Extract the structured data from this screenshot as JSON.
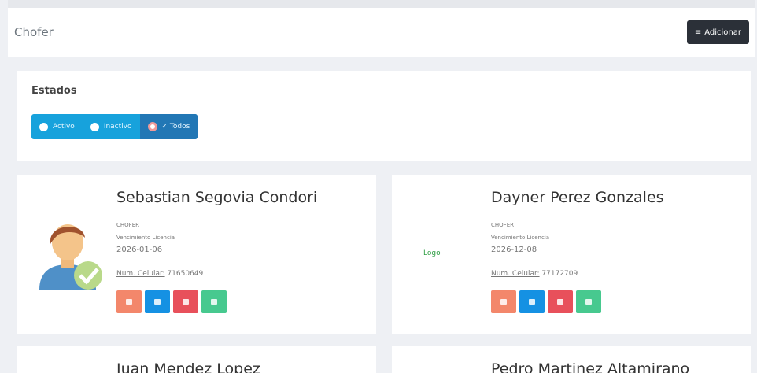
{
  "header": {
    "title": "Chofer",
    "add_label": "Adicionar",
    "add_icon": "list-icon"
  },
  "estados": {
    "label": "Estados",
    "options": [
      {
        "label": "Activo",
        "active": false
      },
      {
        "label": "Inactivo",
        "active": false
      },
      {
        "label": "✓ Todos",
        "active": true
      }
    ]
  },
  "cards": [
    {
      "name": "Sebastian Segovia Condori",
      "role": "CHOFER",
      "license_label": "Vencimiento Licencia",
      "license_date": "2026-01-06",
      "phone_label": "Num. Celular:",
      "phone": "71650649",
      "avatar": "driver-avatar-icon"
    },
    {
      "name": "Dayner Perez Gonzales",
      "role": "CHOFER",
      "license_label": "Vencimiento Licencia",
      "license_date": "2026-12-08",
      "phone_label": "Num. Celular:",
      "phone": "77172709",
      "broken_image_text": "Logo"
    },
    {
      "name": "Juan Mendez Lopez"
    },
    {
      "name": "Pedro Martinez Altamirano"
    }
  ],
  "colors": {
    "edit": "#f3876b",
    "view": "#1591e3",
    "delete": "#e8505b",
    "approve": "#47c98f",
    "toggle": "#17a2dc",
    "toggle_active": "#2277b5"
  }
}
